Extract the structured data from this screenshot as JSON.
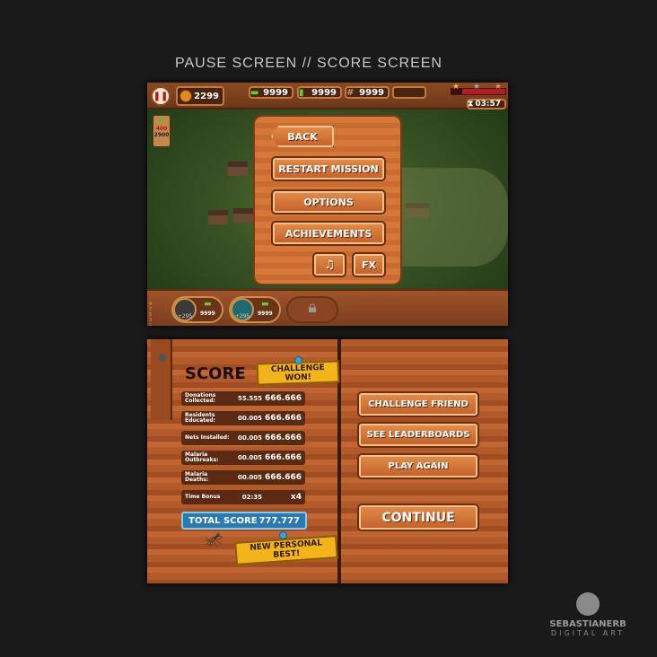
{
  "heading": "PAUSE SCREEN // SCORE SCREEN",
  "pause": {
    "coins": "2299",
    "resources": [
      {
        "icon": "cash-icon",
        "value": "9999"
      },
      {
        "icon": "sprayer-icon",
        "value": "9999"
      },
      {
        "icon": "net-icon",
        "value": "9999"
      }
    ],
    "timer": "03:57",
    "mission_badge": {
      "current": "400",
      "target": "2900"
    },
    "menu": {
      "back": "BACK",
      "restart": "RESTART MISSION",
      "options": "OPTIONS",
      "achievements": "ACHIEVEMENTS",
      "music": "♫",
      "fx": "FX"
    },
    "tools": [
      {
        "icon": "sprayer-icon",
        "bonus": "+295",
        "cost": "9999"
      },
      {
        "icon": "net-icon",
        "bonus": "+295",
        "cost": "9999"
      }
    ],
    "levels": [
      "9",
      "7",
      "5",
      "3",
      "1"
    ]
  },
  "score": {
    "title": "SCORE",
    "challenge_won": "CHALLENGE WON!",
    "rows": [
      {
        "label": "Donations Collected:",
        "value": "55.555",
        "score": "666.666"
      },
      {
        "label": "Residents Educated:",
        "value": "00.005",
        "score": "666.666"
      },
      {
        "label": "Nets Installed:",
        "value": "00.005",
        "score": "666.666"
      },
      {
        "label": "Malaria Outbreaks:",
        "value": "00.005",
        "score": "666.666"
      },
      {
        "label": "Malaria Deaths:",
        "value": "00.005",
        "score": "666.666"
      },
      {
        "label": "Time Bonus",
        "value": "02:35",
        "score": "x4"
      }
    ],
    "total_label": "TOTAL SCORE",
    "total_value": "777.777",
    "personal_best": "NEW PERSONAL BEST!",
    "buttons": {
      "challenge": "CHALLENGE FRIEND",
      "leaderboards": "SEE LEADERBOARDS",
      "play_again": "PLAY AGAIN",
      "continue": "CONTINUE"
    }
  },
  "logo": {
    "name": "SEBASTIANERB",
    "sub": "DIGITAL ART"
  }
}
